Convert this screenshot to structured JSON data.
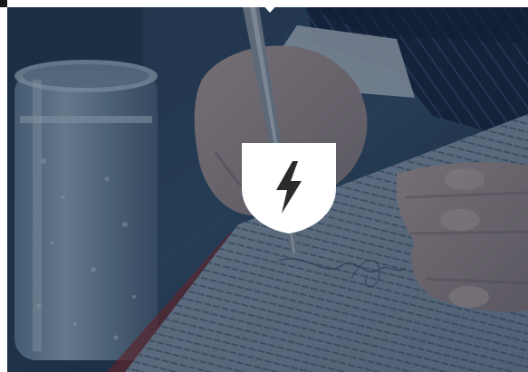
{
  "hero": {
    "image_subject": "hand-signing-document-photo",
    "overlay_color": "#14243a",
    "badge_icon": "lightning-bolt-icon",
    "badge_shape": "shield-icon",
    "badge_color": "#ffffff",
    "icon_color": "#2b2b2b",
    "notch_icon": "down-pointer-notch-icon"
  }
}
